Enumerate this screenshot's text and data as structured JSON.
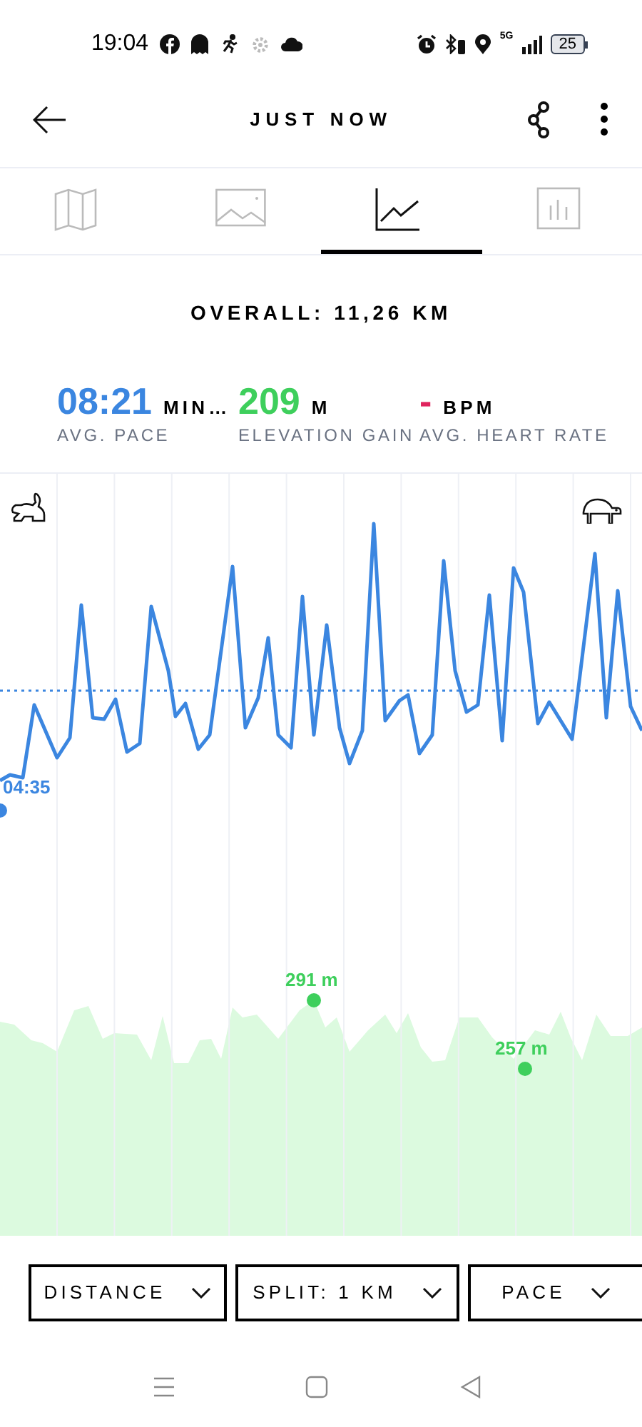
{
  "status_bar": {
    "time": "19:04",
    "network": "5G",
    "battery": "25"
  },
  "header": {
    "title": "JUST NOW"
  },
  "tabs": [
    {
      "kind": "map",
      "selected": false
    },
    {
      "kind": "photos",
      "selected": false
    },
    {
      "kind": "chart",
      "selected": true
    },
    {
      "kind": "splits",
      "selected": false
    }
  ],
  "overall": "OVERALL: 11,26 KM",
  "stats": [
    {
      "value": "08:21",
      "unit": "MIN…",
      "label": "AVG. PACE",
      "color": "#3b86e0"
    },
    {
      "value": "209",
      "unit": "M",
      "label": "ELEVATION GAIN",
      "color": "#3ecf5c"
    },
    {
      "value": "-",
      "unit": "BPM",
      "label": "AVG. HEART RATE",
      "color": "#e0245e"
    }
  ],
  "chart": {
    "markers": [
      {
        "kind": "pace",
        "label": "04:35"
      },
      {
        "kind": "elevation",
        "label": "291 m"
      },
      {
        "kind": "elevation",
        "label": "257 m"
      }
    ]
  },
  "dropdowns": [
    "DISTANCE",
    "SPLIT: 1 KM",
    "PACE"
  ]
}
